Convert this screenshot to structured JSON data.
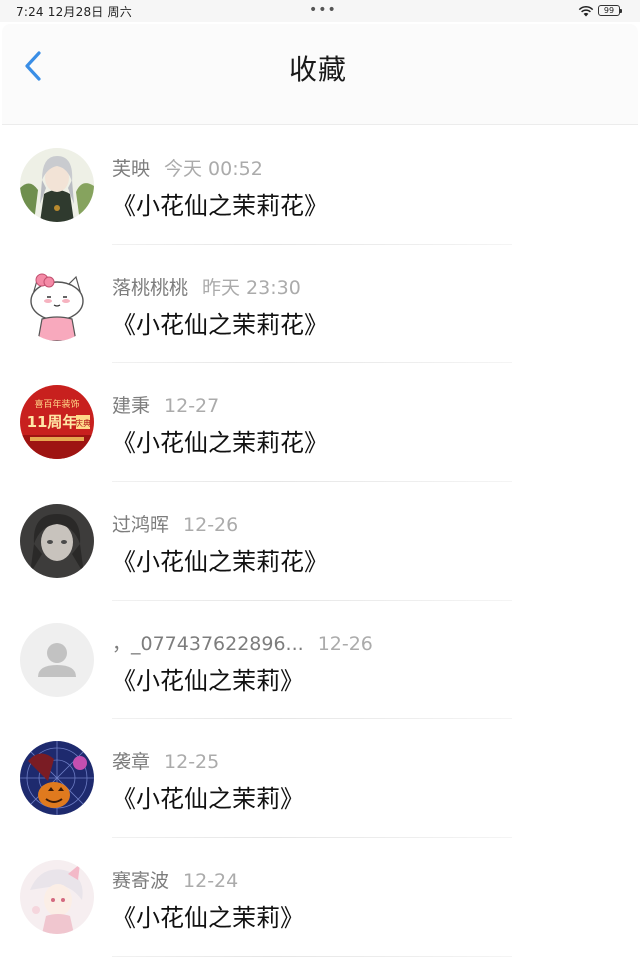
{
  "status_bar": {
    "time": "7:24  12月28日 周六",
    "dots": "•••",
    "battery": "99"
  },
  "header": {
    "title": "收藏"
  },
  "favorites": [
    {
      "name": "芙映",
      "time": "今天 00:52",
      "message": "《小花仙之茉莉花》",
      "avatar_icon": "avatar-anime-character-icon"
    },
    {
      "name": "落桃桃桃",
      "time": "昨天 23:30",
      "message": "《小花仙之茉莉花》",
      "avatar_icon": "avatar-cartoon-cat-icon"
    },
    {
      "name": "建秉",
      "time": "12-27",
      "message": "《小花仙之茉莉花》",
      "avatar_icon": "avatar-red-poster-icon",
      "avatar_text": [
        "喜百年装饰",
        "11周年",
        "庆典"
      ]
    },
    {
      "name": "过鸿晖",
      "time": "12-26",
      "message": "《小花仙之茉莉花》",
      "avatar_icon": "avatar-dark-anime-icon"
    },
    {
      "name": "，_077437622896...",
      "time": "12-26",
      "message": "《小花仙之茉莉》",
      "avatar_icon": "avatar-default-person-icon"
    },
    {
      "name": "袭章",
      "time": "12-25",
      "message": "《小花仙之茉莉》",
      "avatar_icon": "avatar-pumpkin-icon"
    },
    {
      "name": "赛寄波",
      "time": "12-24",
      "message": "《小花仙之茉莉》",
      "avatar_icon": "avatar-pastel-anime-icon"
    }
  ],
  "colors": {
    "accent": "#3a8ee6",
    "name_text": "#7d7d7d",
    "time_text": "#ababab",
    "message_text": "#111111"
  }
}
